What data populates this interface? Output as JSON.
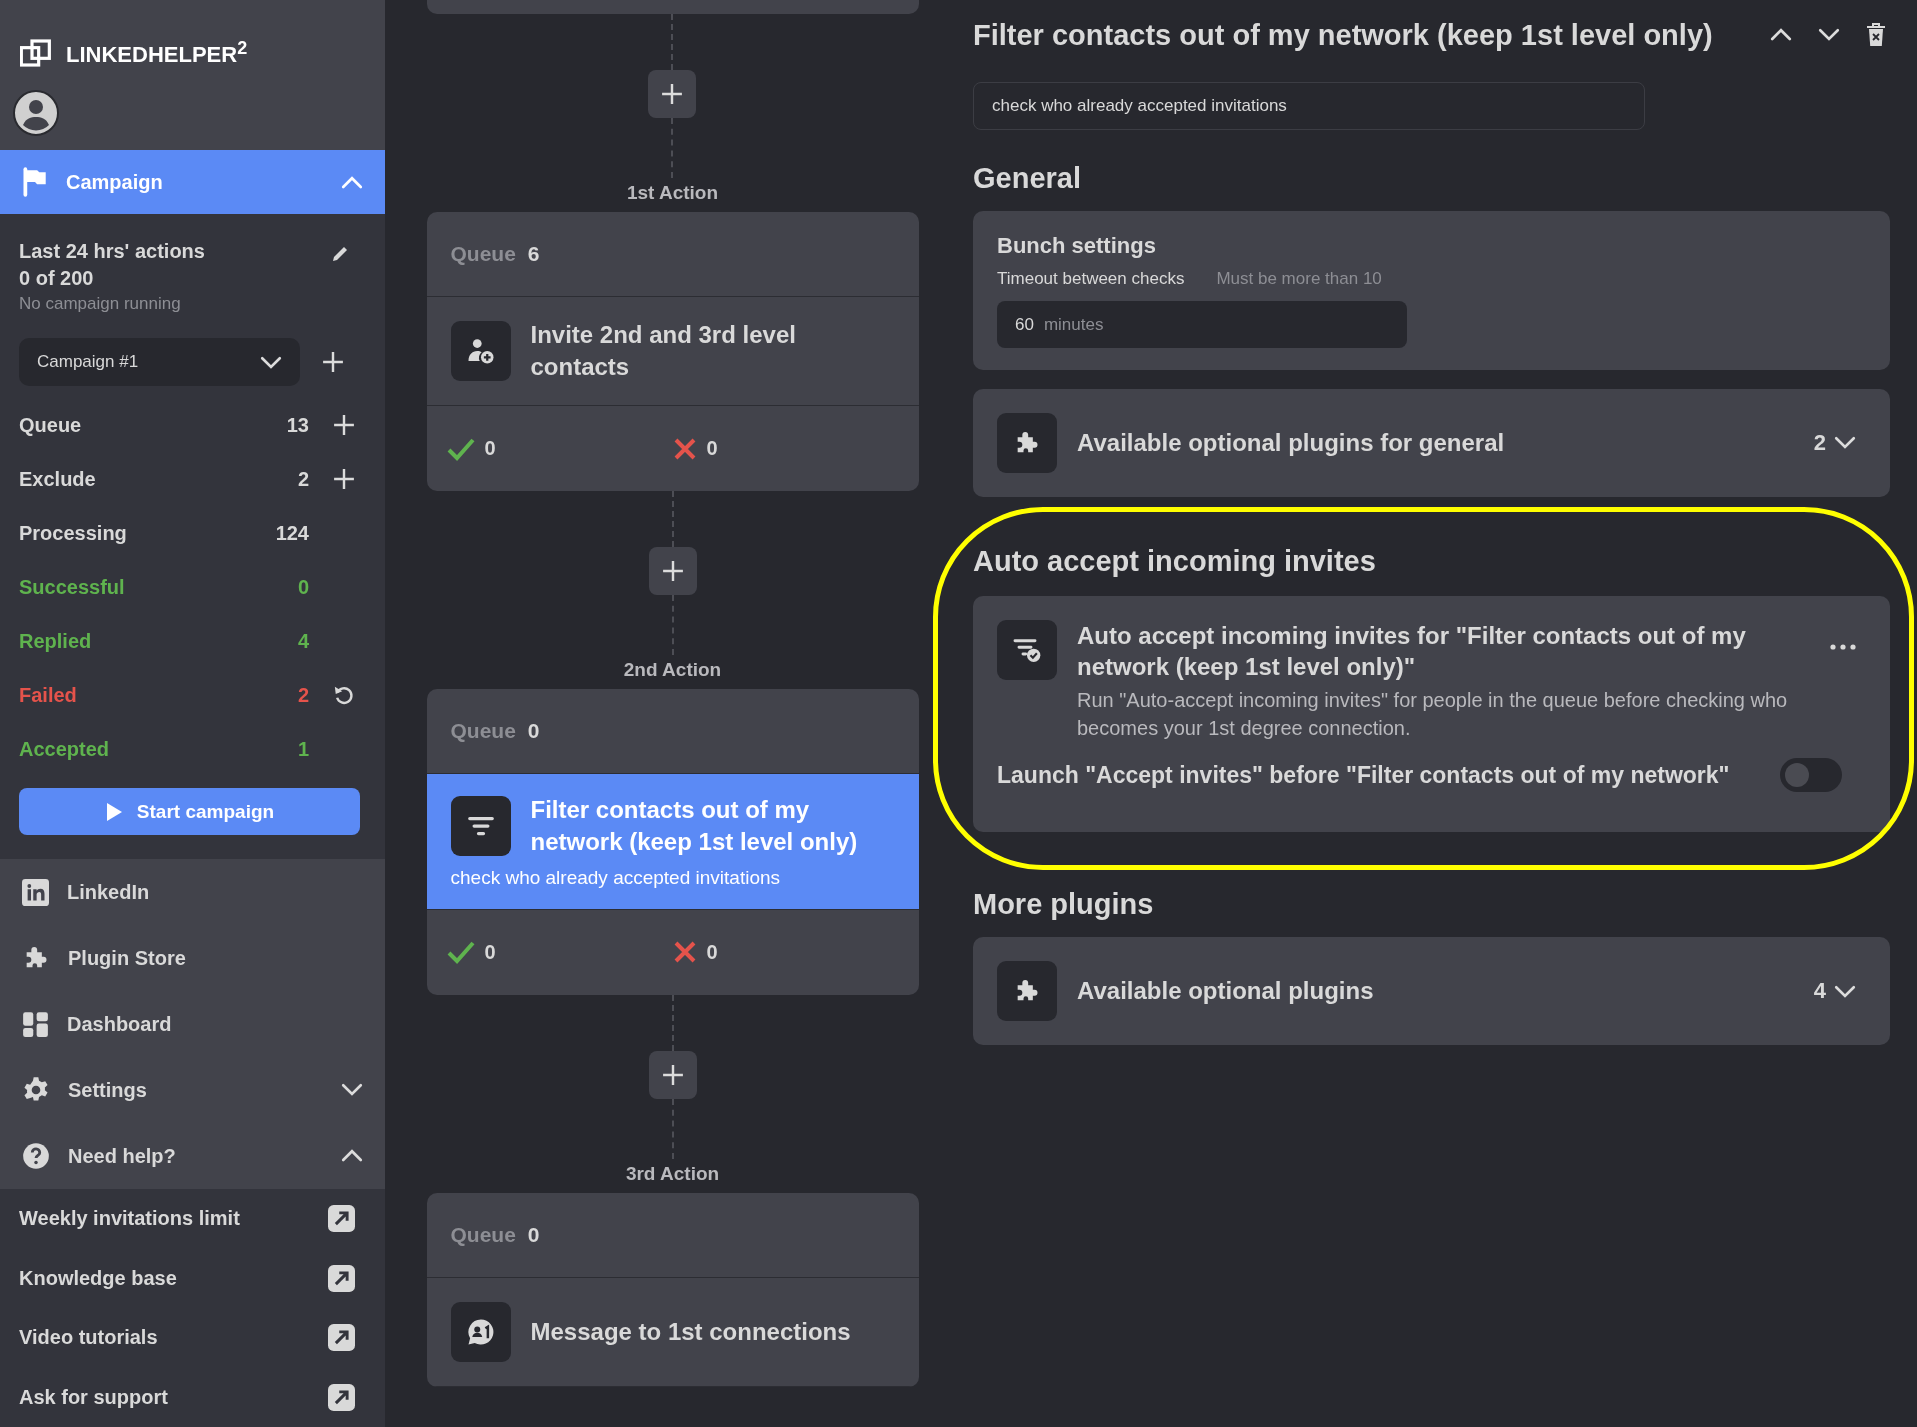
{
  "sidebar": {
    "logo": "LINKEDHELPER",
    "logo_sup": "2",
    "campaign_section": {
      "label": "Campaign",
      "expanded": true
    },
    "summary": {
      "title": "Last 24 hrs' actions",
      "count": "0 of 200",
      "status": "No campaign running"
    },
    "campaign_select": {
      "value": "Campaign #1"
    },
    "stats": [
      {
        "label": "Queue",
        "value": "13",
        "kind": "neutral",
        "add_button": true,
        "retry_button": false
      },
      {
        "label": "Exclude",
        "value": "2",
        "kind": "neutral",
        "add_button": true,
        "retry_button": false
      },
      {
        "label": "Processing",
        "value": "124",
        "kind": "neutral",
        "add_button": false,
        "retry_button": false
      },
      {
        "label": "Successful",
        "value": "0",
        "kind": "success",
        "add_button": false,
        "retry_button": false
      },
      {
        "label": "Replied",
        "value": "4",
        "kind": "success",
        "add_button": false,
        "retry_button": false
      },
      {
        "label": "Failed",
        "value": "2",
        "kind": "failure",
        "add_button": false,
        "retry_button": true
      },
      {
        "label": "Accepted",
        "value": "1",
        "kind": "success",
        "add_button": false,
        "retry_button": false
      }
    ],
    "start_button": "Start campaign",
    "nav": [
      {
        "label": "LinkedIn"
      },
      {
        "label": "Plugin Store"
      },
      {
        "label": "Dashboard"
      },
      {
        "label": "Settings",
        "expanded": false
      },
      {
        "label": "Need help?",
        "expanded": true
      }
    ],
    "help_links": [
      "Weekly invitations limit",
      "Knowledge base",
      "Video tutorials",
      "Ask for support"
    ]
  },
  "flow": {
    "steps": [
      {
        "label": "1st Action",
        "queue_label": "Queue",
        "queue": "6",
        "title": "Invite 2nd and 3rd level contacts",
        "selected": false,
        "success": "0",
        "failure": "0"
      },
      {
        "label": "2nd Action",
        "queue_label": "Queue",
        "queue": "0",
        "title": "Filter contacts out of my network (keep 1st level only)",
        "description": "check who already accepted invitations",
        "selected": true,
        "success": "0",
        "failure": "0"
      },
      {
        "label": "3rd Action",
        "queue_label": "Queue",
        "queue": "0",
        "title": "Message to 1st connections",
        "selected": false
      }
    ]
  },
  "detail": {
    "title": "Filter contacts out of my network (keep 1st level only)",
    "description_field": {
      "value": "check who already accepted invitations"
    },
    "general": {
      "heading": "General",
      "bunch": {
        "title": "Bunch settings",
        "label": "Timeout between checks",
        "hint": "Must be more than 10",
        "value": "60",
        "unit": "minutes"
      },
      "plugins": {
        "label": "Available optional plugins for general",
        "count": "2"
      }
    },
    "auto_accept": {
      "heading": "Auto accept incoming invites",
      "title": "Auto accept incoming invites for \"Filter contacts out of my network (keep 1st level only)\"",
      "description": "Run \"Auto-accept incoming invites\" for people in the queue before checking who becomes your 1st degree connection.",
      "toggle": {
        "label": "Launch \"Accept invites\" before \"Filter contacts out of my network\"",
        "on": false
      }
    },
    "more_plugins": {
      "heading": "More plugins",
      "plugins": {
        "label": "Available optional plugins",
        "count": "4"
      }
    }
  }
}
